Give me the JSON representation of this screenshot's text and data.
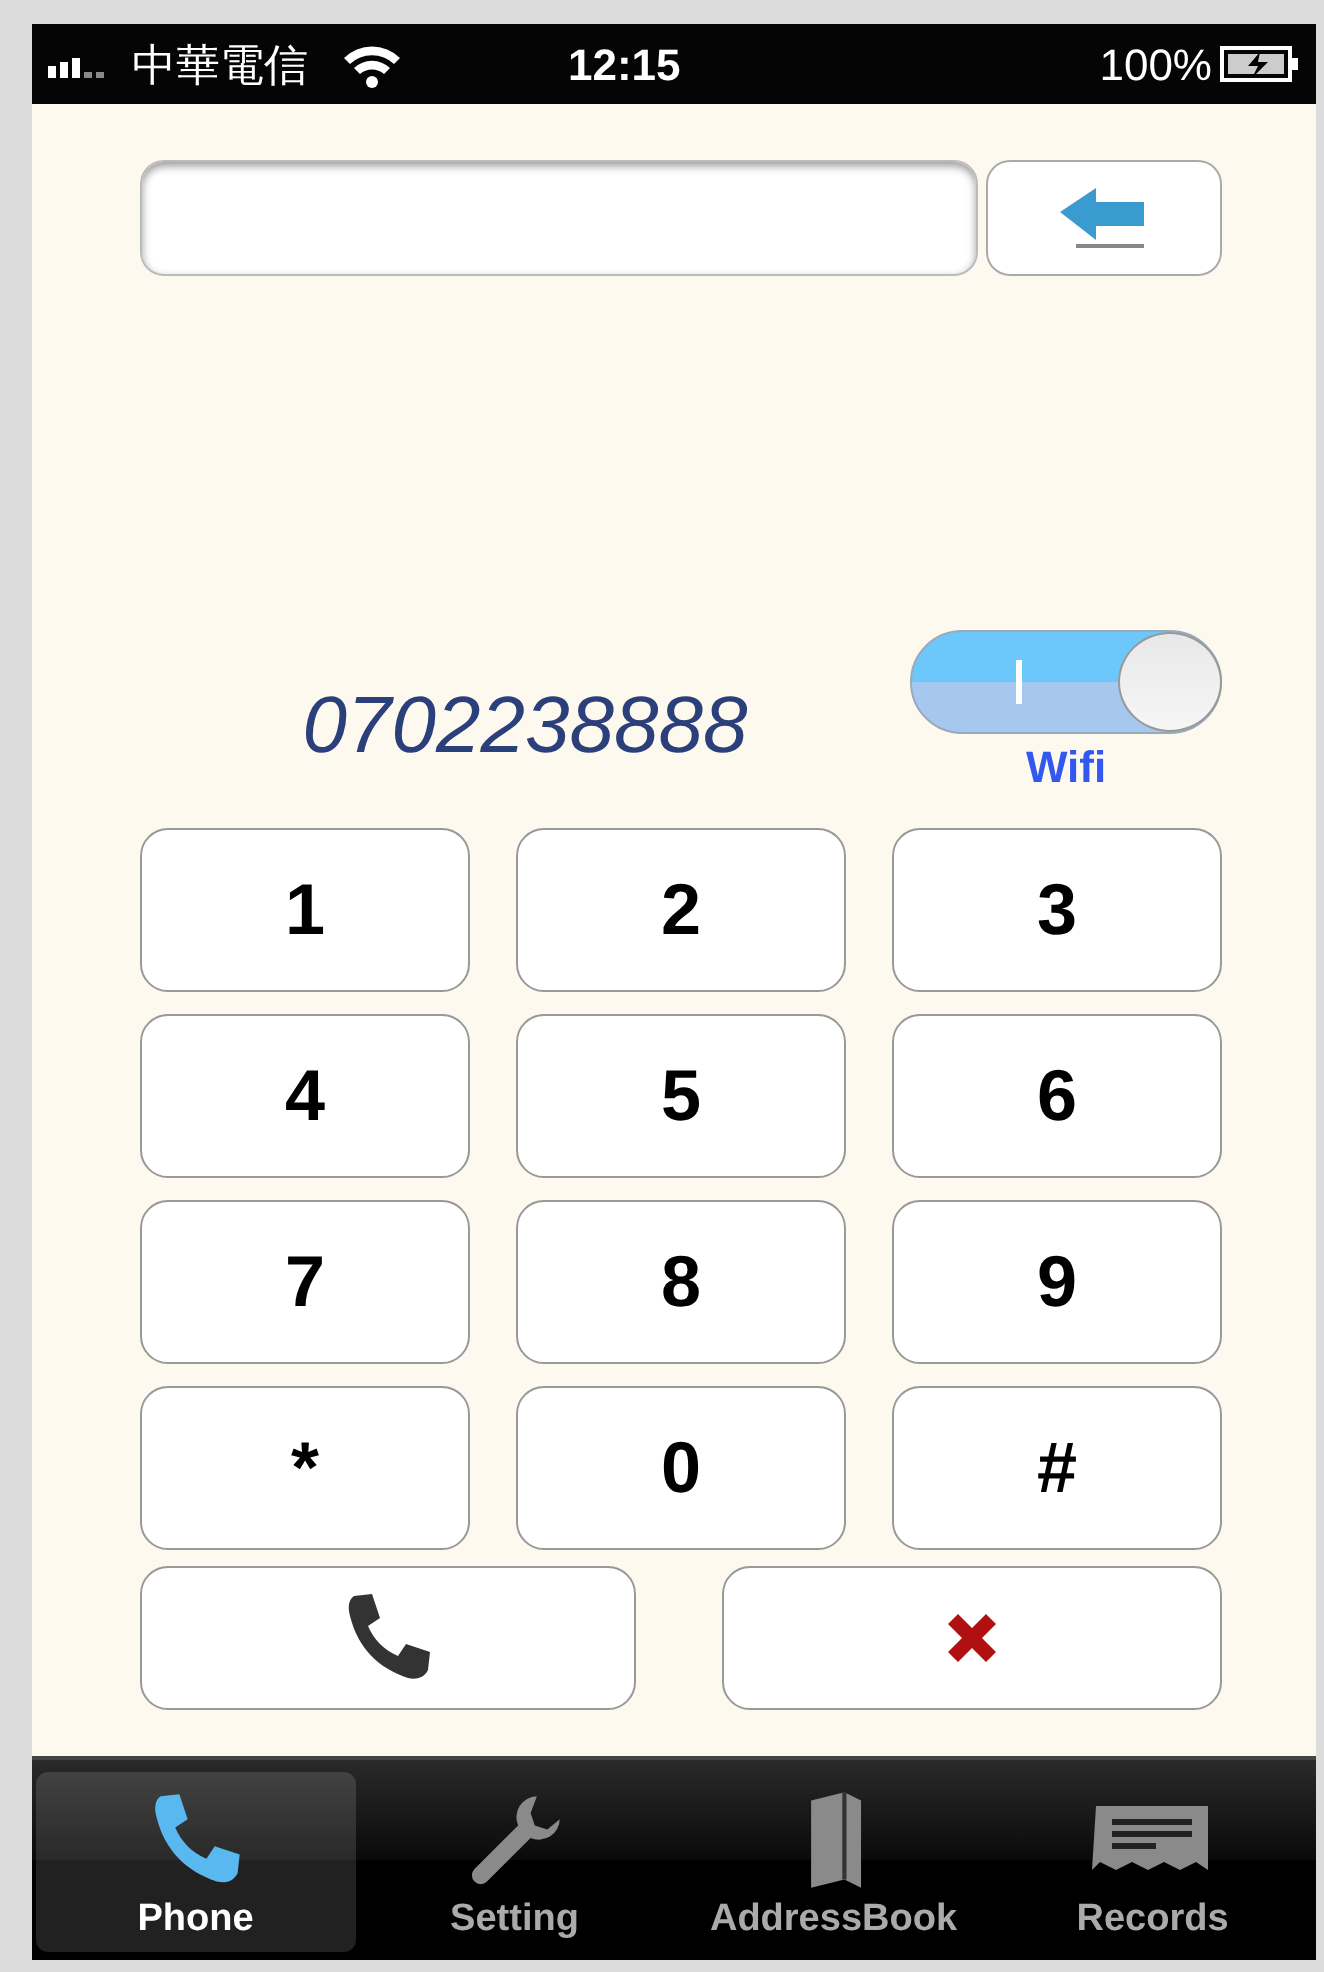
{
  "status_bar": {
    "carrier": "中華電信",
    "time": "12:15",
    "battery": "100%"
  },
  "dialed_number": "0702238888",
  "wifi_switch": {
    "on": true,
    "label": "Wifi"
  },
  "keypad": [
    {
      "label": "1"
    },
    {
      "label": "2"
    },
    {
      "label": "3"
    },
    {
      "label": "4"
    },
    {
      "label": "5"
    },
    {
      "label": "6"
    },
    {
      "label": "7"
    },
    {
      "label": "8"
    },
    {
      "label": "9"
    },
    {
      "label": "*"
    },
    {
      "label": "0"
    },
    {
      "label": "#"
    }
  ],
  "tabs": [
    {
      "label": "Phone",
      "selected": true
    },
    {
      "label": "Setting",
      "selected": false
    },
    {
      "label": "AddressBook",
      "selected": false
    },
    {
      "label": "Records",
      "selected": false
    }
  ]
}
